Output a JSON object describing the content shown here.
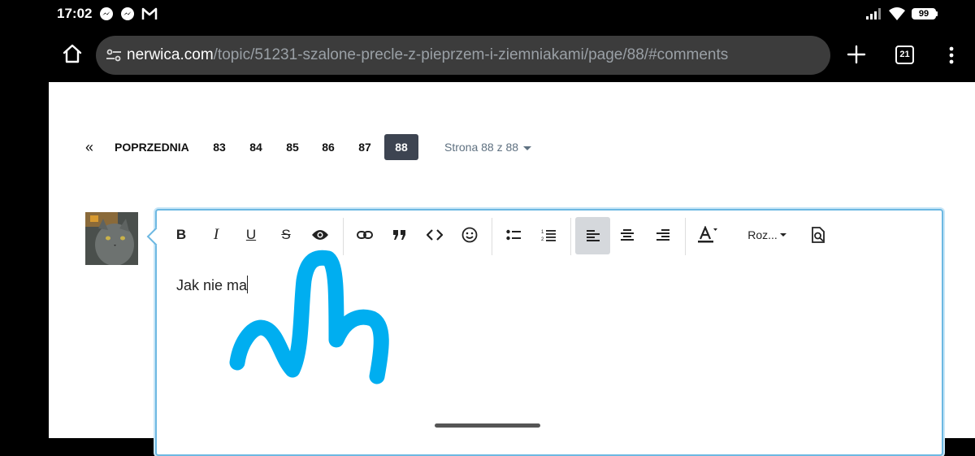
{
  "status_bar": {
    "time": "17:02",
    "battery": "99",
    "notification_icons": [
      "messenger-icon",
      "messenger-icon",
      "gmail-icon"
    ],
    "system_icons": [
      "signal-icon",
      "wifi-icon",
      "battery-icon"
    ]
  },
  "browser": {
    "url_domain": "nerwica.com",
    "url_path": "/topic/51231-szalone-precle-z-pieprzem-i-ziemniakami/page/88/#comments",
    "tab_count": "21"
  },
  "pagination": {
    "first_label": "«",
    "prev_label": "POPRZEDNIA",
    "pages": [
      "83",
      "84",
      "85",
      "86",
      "87"
    ],
    "current": "88",
    "jump_label": "Strona 88 z 88"
  },
  "editor": {
    "toolbar": {
      "bold_label": "B",
      "italic_label": "I",
      "underline_label": "U",
      "strike_label": "S",
      "format_label": "Roz..."
    },
    "active_alignment": "left",
    "content": "Jak nie ma"
  },
  "colors": {
    "accent_border": "#6db8e2",
    "current_page_bg": "#3d4451",
    "scribble": "#00aef0"
  }
}
